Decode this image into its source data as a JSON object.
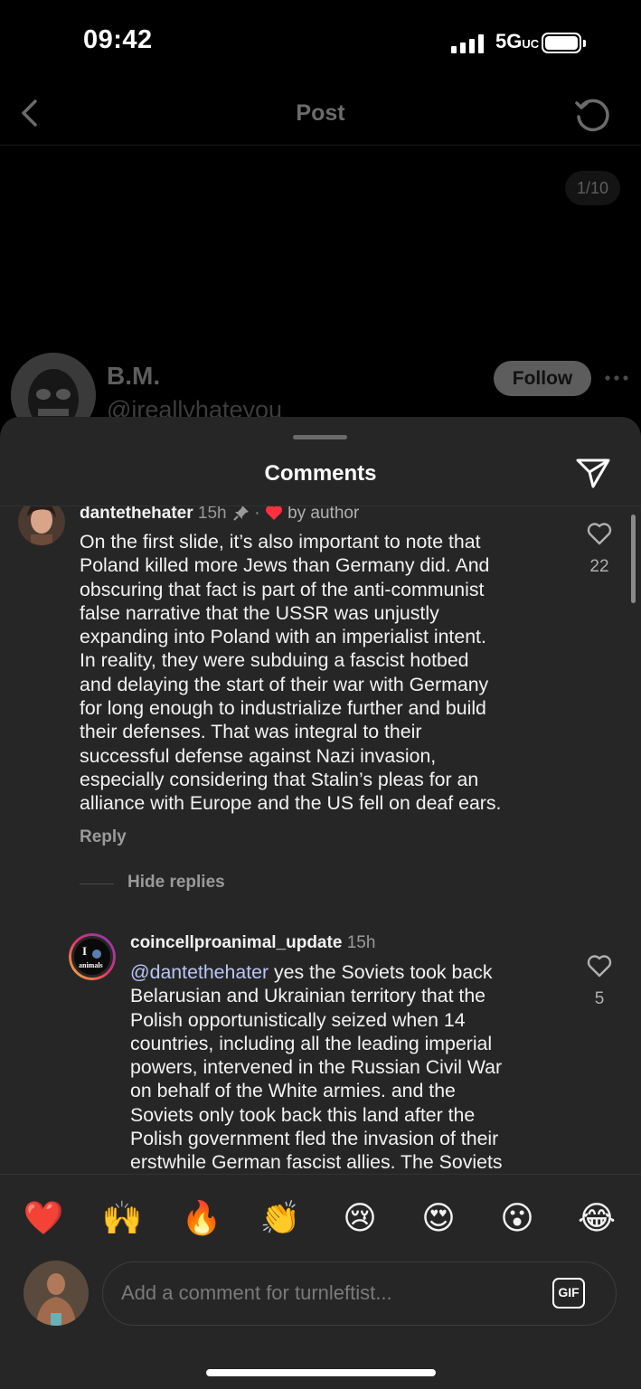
{
  "status_bar": {
    "time": "09:42",
    "network": "5G",
    "network_suffix": "UC"
  },
  "header": {
    "title": "Post"
  },
  "post": {
    "page_counter": "1/10",
    "author_name": "B.M.",
    "author_handle": "@ireallyhateyou",
    "follow_label": "Follow"
  },
  "sheet": {
    "title": "Comments"
  },
  "comments": [
    {
      "username": "dantethehater",
      "time": "15h",
      "pinned": true,
      "liked_by_author_label": "by author",
      "lines": [
        "On the first slide, it’s also important to note that",
        "Poland killed more Jews than Germany did. And",
        "obscuring that fact is part of the anti-communist",
        "false narrative that the USSR was unjustly",
        "expanding into Poland with an imperialist intent.",
        "In reality, they were subduing a fascist hotbed",
        "and delaying the start of their war with Germany",
        "for long enough to industrialize further and build",
        "their defenses. That was integral to their",
        "successful defense against Nazi invasion,",
        "especially considering that Stalin’s pleas for an",
        "alliance with Europe and the US fell on deaf ears."
      ],
      "likes": "22",
      "reply_label": "Reply",
      "hide_replies_label": "Hide replies"
    },
    {
      "username": "coincellproanimal_update",
      "time": "15h",
      "mention": "@dantethehater",
      "first_line_rest": " yes the Soviets took back",
      "lines": [
        "Belarusian and Ukrainian territory that the",
        "Polish opportunistically seized when 14",
        "countries, including all the leading imperial",
        "powers, intervened in the Russian Civil War",
        "on behalf of the White armies. and the",
        "Soviets only took back this land after the",
        "Polish government fled the invasion of their",
        "erstwhile German fascist allies. The Soviets"
      ],
      "likes": "5",
      "avatar_text_top": "I",
      "avatar_text_bottom": "animals"
    }
  ],
  "reactions": [
    "❤️",
    "🙌",
    "🔥",
    "👏",
    "😢",
    "😍",
    "😮",
    "😂"
  ],
  "composer": {
    "placeholder": "Add a comment for turnleftist...",
    "gif_label": "GIF"
  },
  "colors": {
    "background": "#000000",
    "sheet": "#262626",
    "heart_red": "#ff3040",
    "mention": "#b9c6f5",
    "muted_text": "#9a9a9a"
  },
  "icons": [
    "back-arrow-icon",
    "refresh-icon",
    "more-icon",
    "share-icon",
    "pin-icon",
    "heart-icon",
    "gif-icon"
  ]
}
